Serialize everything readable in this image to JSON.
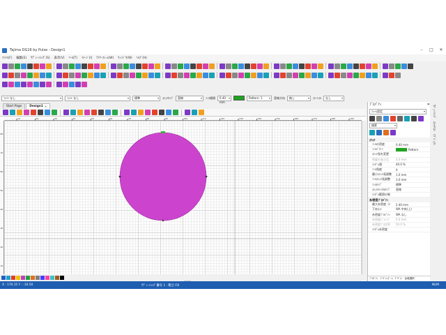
{
  "window": {
    "title": "Tajima DG16 by Pulse - Design1"
  },
  "menu": [
    "ﾌｧｲﾙ(F)",
    "編集(E)",
    "ｻﾃﾞｭｰﾝｼﾝｸﾞ(S)",
    "表示(V)",
    "ﾂｰﾙ(T)",
    "ｲﾒｰｼﾞ(I)",
    "ﾜｲﾔｰﾌﾚｰﾑ(W)",
    "ｳｨﾝﾄﾞｳ(W)",
    "ﾍﾙﾌﾟ(H)"
  ],
  "props": {
    "font1": "ﾌｫﾝﾄ なし",
    "font2": "ﾌｫﾝﾄ なし",
    "standard": "標準",
    "stitch_type_label": "ｽﾃｯﾁﾀｲﾌﾟ",
    "stitch_type": "直線",
    "spacing_label": "ﾌｨﾙ間隔",
    "spacing_value": "0.40 mm",
    "pattern": "Pattern: 1",
    "stitch_dir_label": "直線方向",
    "stitch_dir": "無し",
    "hole_label": "ｽﾃｰﾄｽﾙ",
    "hole": "なし"
  },
  "tabs": [
    {
      "label": "Start Page"
    },
    {
      "label": "Design1"
    }
  ],
  "ruler": {
    "h": [
      "10",
      "20",
      "30",
      "40",
      "50",
      "60",
      "70",
      "80",
      "90",
      "100",
      "110",
      "120",
      "130",
      "140",
      "150",
      "160",
      "170",
      "180",
      "190"
    ],
    "v": [
      "80",
      "70",
      "60",
      "50",
      "40",
      "30",
      "20",
      "10"
    ]
  },
  "status": {
    "coords": "X : 170.15 Y : -10.50",
    "center": "ｻﾃﾞｭｰﾝｼﾝｸﾞ番号 1 : 粗さ.Fill",
    "num": "NUM"
  },
  "panel": {
    "title": "ﾌﾟﾛﾊﾟﾃｨ",
    "object": "ﾌｫｰﾑ設定",
    "search": "検索",
    "cat1": "ｽﾃｯﾁ",
    "rows1": [
      {
        "k": "ﾌｨﾙの密度",
        "v": "0.40 mm"
      },
      {
        "k": "ﾌｨﾙﾊﾟﾀｰﾝ",
        "v": "Pattern"
      },
      {
        "k": "ｽﾃｯﾁ長を変更",
        "v": ""
      },
      {
        "k": "密度の長さ比",
        "v": "4.0 mm",
        "d": true
      },
      {
        "k": "ﾗﾝﾀﾞﾑ値",
        "v": "40.0 %"
      },
      {
        "k": "ﾌｨﾙ角度",
        "v": "0"
      },
      {
        "k": "最小ｽﾃｯﾁ長調整",
        "v": "1.0 mm"
      },
      {
        "k": "ﾌｨﾙｽﾃｯﾁ長調整",
        "v": "3.0 mm"
      },
      {
        "k": "ﾌｨﾙﾀｲﾌﾟ",
        "v": "標準"
      },
      {
        "k": "ｽﾃｯﾁﾁｬﾝﾈﾙﾀｲﾌﾟ",
        "v": "直線"
      },
      {
        "k": "ﾗﾝﾀﾞﾑ範囲の制",
        "v": ""
      }
    ],
    "cat2": "糸密度ﾌﾟﾛﾊﾟﾃｨ",
    "rows2": [
      {
        "k": "最大糸密度（ﾊ",
        "v": "2.40 mm"
      },
      {
        "k": "下糸ｶｯﾄ",
        "v": "WA 中央(上)"
      },
      {
        "k": "糸密度ﾌﾟﾛﾊﾟﾃｨ",
        "v": "WA なし"
      },
      {
        "k": "糸密度ﾊﾟﾗﾒｰﾀ",
        "v": "0.0 mm",
        "d": true
      },
      {
        "k": "糸密度ﾌﾟﾛ比率",
        "v": "50.0 %",
        "d": true
      },
      {
        "k": "ﾗﾝﾀﾞﾑ糸密度",
        "v": ""
      }
    ],
    "bottom_tabs": [
      "ﾌﾟﾛﾊﾟﾃｨ",
      "ﾃﾞｻﾞｲﾝｽﾞｰﾑ",
      "ﾃﾞｻﾞｲﾝ",
      "全域選択"
    ]
  },
  "side_tabs": [
    "ｻﾃﾞｭｰﾝｼﾝｸﾞ",
    "ｽﾃｯﾁﾘｽﾄ",
    "ｵﾌﾞｼﾞｪｸﾄ"
  ],
  "colors": {
    "fill": "#d84fd8",
    "fill_dark": "#b12bb5",
    "accent": "#1e5db0"
  }
}
